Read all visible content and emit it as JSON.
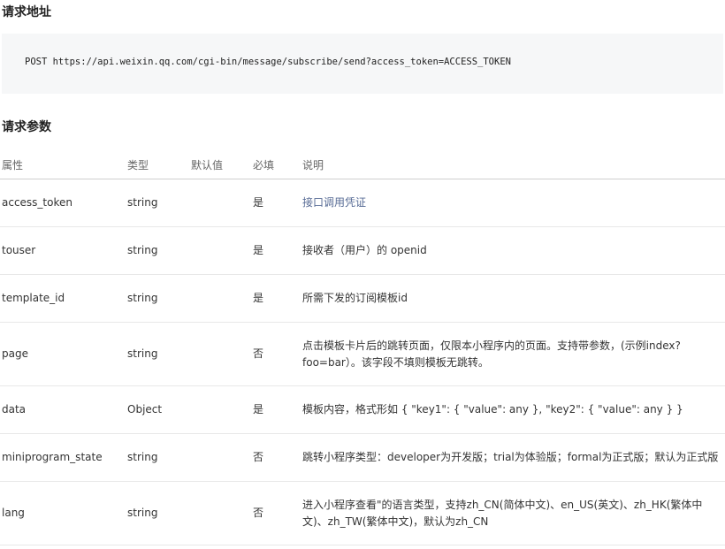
{
  "request_url": {
    "heading": "请求地址",
    "code": "POST https://api.weixin.qq.com/cgi-bin/message/subscribe/send?access_token=ACCESS_TOKEN"
  },
  "request_params": {
    "heading": "请求参数",
    "columns": [
      "属性",
      "类型",
      "默认值",
      "必填",
      "说明"
    ],
    "rows": [
      {
        "name": "access_token",
        "type": "string",
        "default": "",
        "required": "是",
        "desc": "接口调用凭证"
      },
      {
        "name": "touser",
        "type": "string",
        "default": "",
        "required": "是",
        "desc": "接收者（用户）的 openid"
      },
      {
        "name": "template_id",
        "type": "string",
        "default": "",
        "required": "是",
        "desc": "所需下发的订阅模板id"
      },
      {
        "name": "page",
        "type": "string",
        "default": "",
        "required": "否",
        "desc": "点击模板卡片后的跳转页面，仅限本小程序内的页面。支持带参数，(示例index?foo=bar）。该字段不填则模板无跳转。"
      },
      {
        "name": "data",
        "type": "Object",
        "default": "",
        "required": "是",
        "desc": "模板内容，格式形如 { \"key1\": { \"value\": any }, \"key2\": { \"value\": any } }"
      },
      {
        "name": "miniprogram_state",
        "type": "string",
        "default": "",
        "required": "否",
        "desc": "跳转小程序类型：developer为开发版；trial为体验版；formal为正式版；默认为正式版"
      },
      {
        "name": "lang",
        "type": "string",
        "default": "",
        "required": "否",
        "desc": "进入小程序查看\"的语言类型，支持zh_CN(简体中文)、en_US(英文)、zh_HK(繁体中文)、zh_TW(繁体中文)，默认为zh_CN"
      }
    ]
  },
  "colors": {
    "link": "#576b95",
    "code_background": "#f6f7f8",
    "header_border": "#cfcfcf",
    "row_border": "#e8e8e8"
  }
}
